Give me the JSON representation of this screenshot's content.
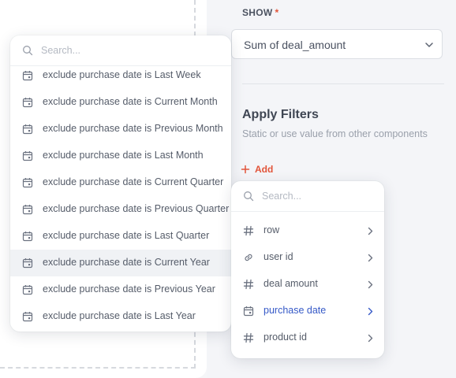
{
  "show": {
    "label": "SHOW",
    "required_mark": "*",
    "value": "Sum of deal_amount"
  },
  "filters": {
    "title": "Apply Filters",
    "subtitle": "Static or use value from other components",
    "add_label": "Add"
  },
  "date_options": {
    "search_placeholder": "Search...",
    "items": [
      "exclude purchase date is Last Week",
      "exclude purchase date is Current Month",
      "exclude purchase date is Previous Month",
      "exclude purchase date is Last Month",
      "exclude purchase date is Current Quarter",
      "exclude purchase date is Previous Quarter",
      "exclude purchase date is Last Quarter",
      "exclude purchase date is Current Year",
      "exclude purchase date is Previous Year",
      "exclude purchase date is Last Year"
    ],
    "highlighted": "exclude purchase date is Current Year"
  },
  "field_picker": {
    "search_placeholder": "Search...",
    "fields": [
      {
        "label": "row",
        "icon": "hash-icon"
      },
      {
        "label": "user id",
        "icon": "link-icon"
      },
      {
        "label": "deal amount",
        "icon": "hash-icon"
      },
      {
        "label": "purchase date",
        "icon": "calendar-icon",
        "active": true
      },
      {
        "label": "product id",
        "icon": "hash-icon"
      }
    ]
  },
  "colors": {
    "accent": "#e2553a",
    "active": "#3559c7",
    "text": "#555c69"
  }
}
